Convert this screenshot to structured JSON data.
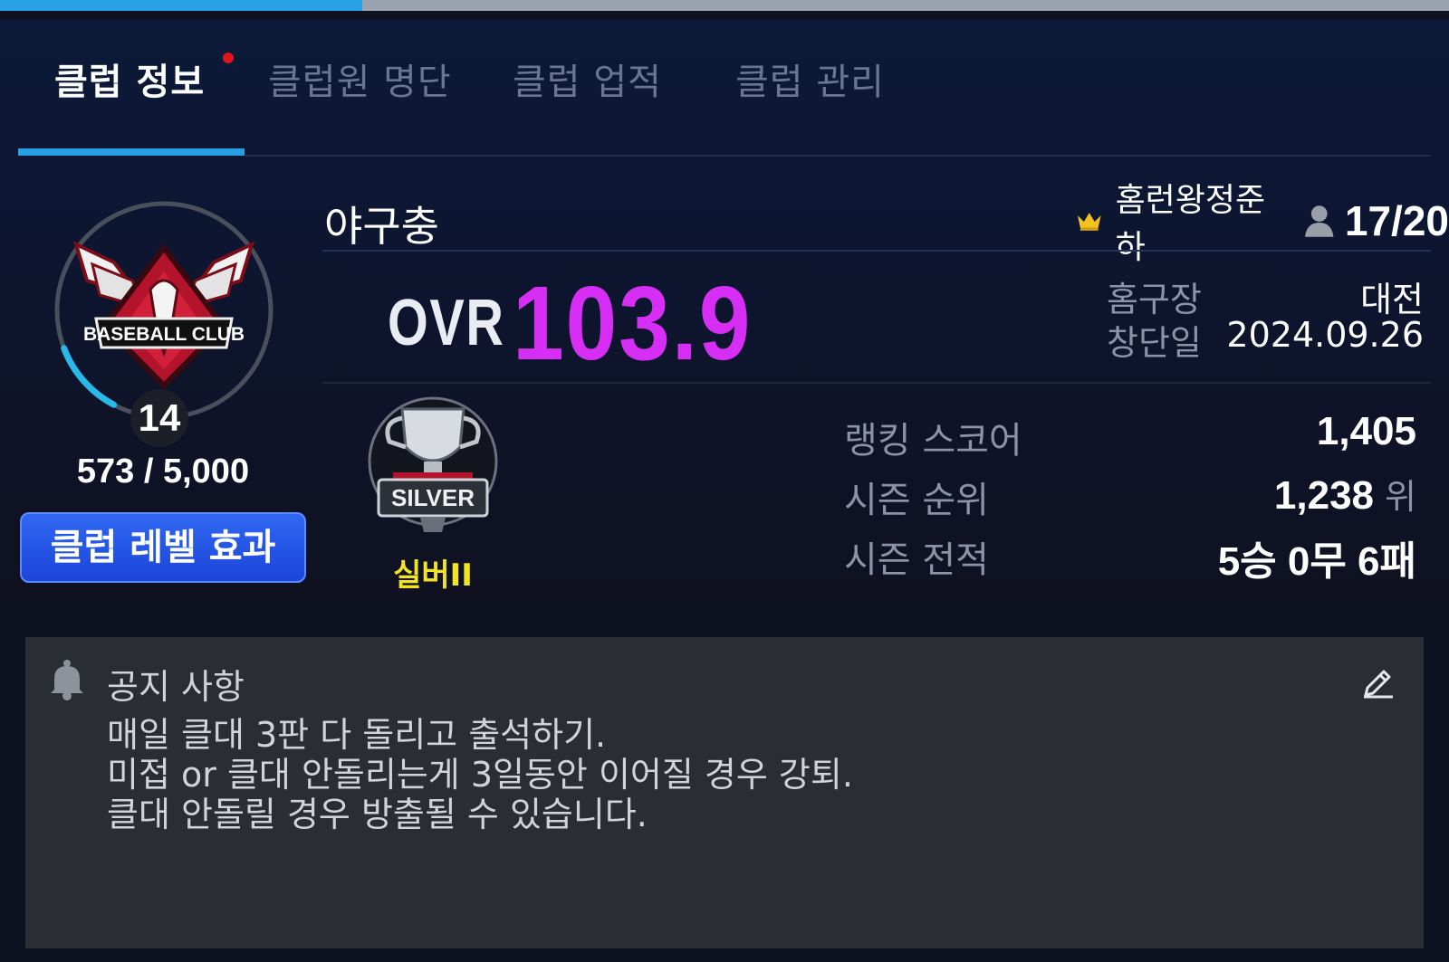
{
  "progress": {
    "fill_fraction": 0.25
  },
  "tabs": [
    {
      "label": "클럽 정보",
      "active": true
    },
    {
      "label": "클럽원 명단",
      "active": false
    },
    {
      "label": "클럽 업적",
      "active": false
    },
    {
      "label": "클럽 관리",
      "active": false
    }
  ],
  "club": {
    "name": "야구충",
    "emblem_text": "BASEBALL CLUB",
    "level": "14",
    "exp": "573 / 5,000",
    "exp_fraction": 0.1146,
    "level_effect_button": "클럽 레벨 효과",
    "owner_name": "홈런왕정준하",
    "members": "17/20",
    "ovr_label": "OVR",
    "ovr_value": "103.9",
    "home_label": "홈구장",
    "home_value": "대전",
    "founded_label": "창단일",
    "founded_value": "2024.09.26"
  },
  "league": {
    "emblem_text": "SILVER",
    "name": "실버II"
  },
  "stats": {
    "ranking_score_label": "랭킹 스코어",
    "ranking_score_value": "1,405",
    "season_rank_label": "시즌 순위",
    "season_rank_value": "1,238",
    "season_rank_unit": "위",
    "season_record_label": "시즌 전적",
    "season_record_value": "5승 0무 6패"
  },
  "notice": {
    "title": "공지 사항",
    "lines": [
      "매일 클대 3판 다 돌리고 출석하기.",
      "미접 or 클대 안돌리는게 3일동안 이어질 경우 강퇴.",
      "클대 안돌릴 경우 방출될 수 있습니다."
    ]
  },
  "colors": {
    "accent": "#27a0e3",
    "ovr": "#d62ef5",
    "league": "#f2e425",
    "button": "#2f67f2"
  },
  "icons": [
    "crown-icon",
    "person-icon",
    "bell-icon",
    "edit-icon"
  ]
}
